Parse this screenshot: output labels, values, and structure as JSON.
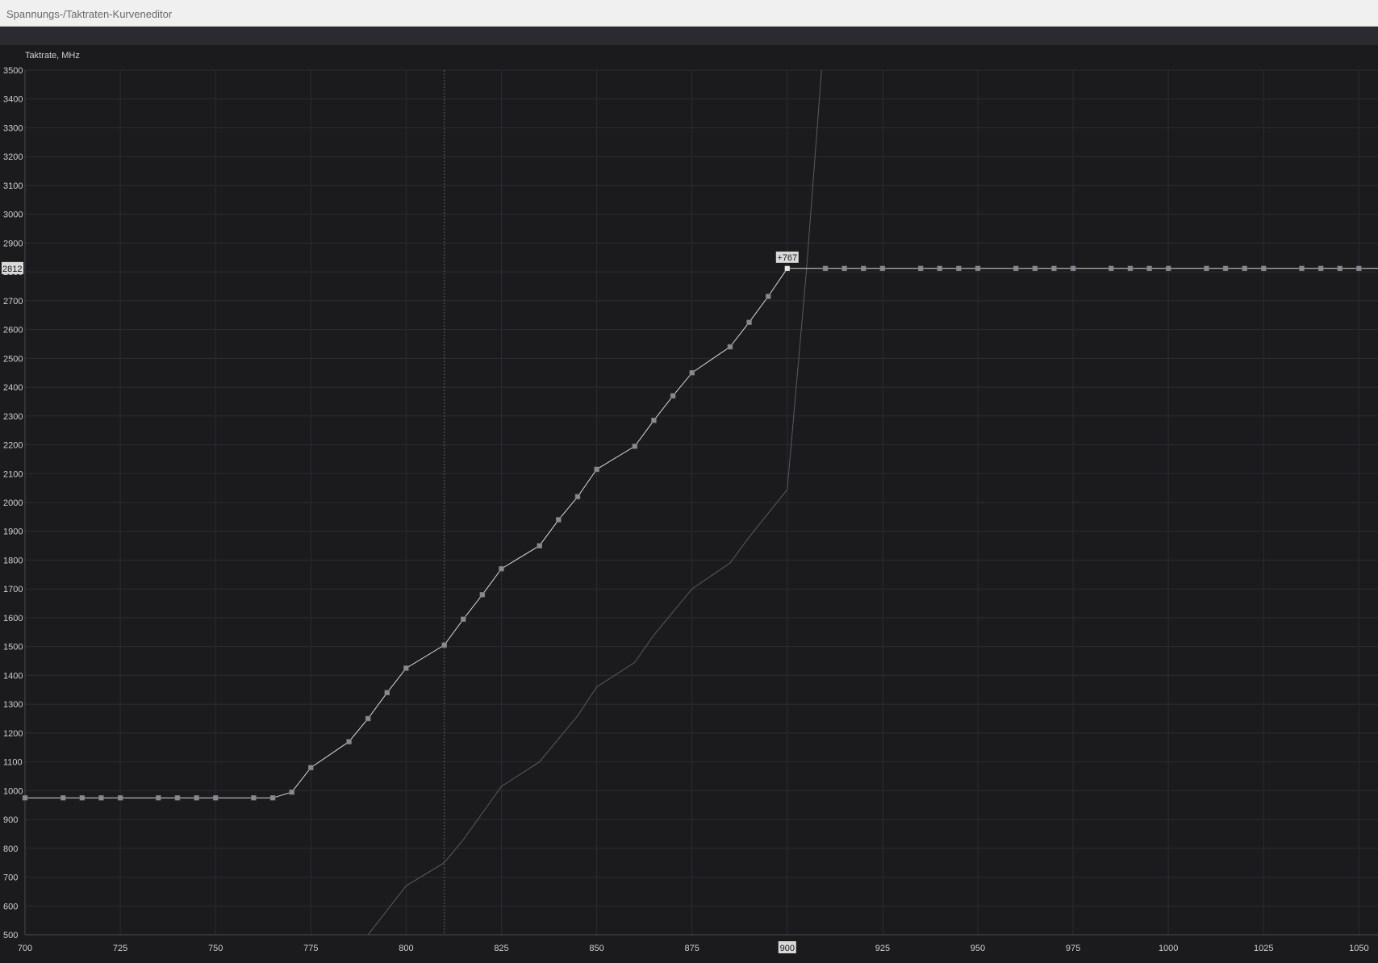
{
  "window": {
    "title": "Spannungs-/Taktraten-Kurveneditor"
  },
  "chart_data": {
    "type": "line",
    "ylabel": "Taktrate, MHz",
    "xlim": [
      700,
      1055
    ],
    "ylim": [
      500,
      3500
    ],
    "x_ticks": [
      700,
      725,
      750,
      775,
      800,
      825,
      850,
      875,
      900,
      925,
      950,
      975,
      1000,
      1025,
      1050
    ],
    "y_ticks": [
      500,
      600,
      700,
      800,
      900,
      1000,
      1100,
      1200,
      1300,
      1400,
      1500,
      1600,
      1700,
      1800,
      1900,
      2000,
      2100,
      2200,
      2300,
      2400,
      2500,
      2600,
      2700,
      2800,
      2900,
      3000,
      3100,
      3200,
      3300,
      3400,
      3500
    ],
    "grid": true,
    "cursor": {
      "x": 810,
      "x_label": "900",
      "y_label": "2812",
      "offset_label": "+767",
      "point": [
        900,
        2812
      ]
    },
    "series": [
      {
        "color": "#d8d8d8",
        "markers": true,
        "points": [
          [
            700,
            975
          ],
          [
            710,
            975
          ],
          [
            715,
            975
          ],
          [
            720,
            975
          ],
          [
            725,
            975
          ],
          [
            735,
            975
          ],
          [
            740,
            975
          ],
          [
            745,
            975
          ],
          [
            750,
            975
          ],
          [
            760,
            975
          ],
          [
            765,
            975
          ],
          [
            770,
            995
          ],
          [
            775,
            1080
          ],
          [
            785,
            1170
          ],
          [
            790,
            1250
          ],
          [
            795,
            1340
          ],
          [
            800,
            1425
          ],
          [
            810,
            1505
          ],
          [
            815,
            1595
          ],
          [
            820,
            1680
          ],
          [
            825,
            1770
          ],
          [
            835,
            1850
          ],
          [
            840,
            1940
          ],
          [
            845,
            2020
          ],
          [
            850,
            2115
          ],
          [
            860,
            2195
          ],
          [
            865,
            2285
          ],
          [
            870,
            2370
          ],
          [
            875,
            2450
          ],
          [
            885,
            2540
          ],
          [
            890,
            2625
          ],
          [
            895,
            2715
          ],
          [
            900,
            2812
          ],
          [
            910,
            2812
          ],
          [
            915,
            2812
          ],
          [
            920,
            2812
          ],
          [
            925,
            2812
          ],
          [
            935,
            2812
          ],
          [
            940,
            2812
          ],
          [
            945,
            2812
          ],
          [
            950,
            2812
          ],
          [
            960,
            2812
          ],
          [
            965,
            2812
          ],
          [
            970,
            2812
          ],
          [
            975,
            2812
          ],
          [
            985,
            2812
          ],
          [
            990,
            2812
          ],
          [
            995,
            2812
          ],
          [
            1000,
            2812
          ],
          [
            1010,
            2812
          ],
          [
            1015,
            2812
          ],
          [
            1020,
            2812
          ],
          [
            1025,
            2812
          ],
          [
            1035,
            2812
          ],
          [
            1040,
            2812
          ],
          [
            1045,
            2812
          ],
          [
            1050,
            2812
          ],
          [
            1055,
            2812
          ]
        ]
      },
      {
        "color": "#5a5a5e",
        "markers": false,
        "points": [
          [
            790,
            500
          ],
          [
            800,
            670
          ],
          [
            810,
            750
          ],
          [
            815,
            830
          ],
          [
            825,
            1015
          ],
          [
            835,
            1100
          ],
          [
            845,
            1260
          ],
          [
            850,
            1360
          ],
          [
            860,
            1445
          ],
          [
            865,
            1540
          ],
          [
            875,
            1700
          ],
          [
            885,
            1790
          ],
          [
            890,
            1880
          ],
          [
            900,
            2045
          ],
          [
            905,
            2800
          ],
          [
            909,
            3500
          ]
        ]
      }
    ]
  }
}
